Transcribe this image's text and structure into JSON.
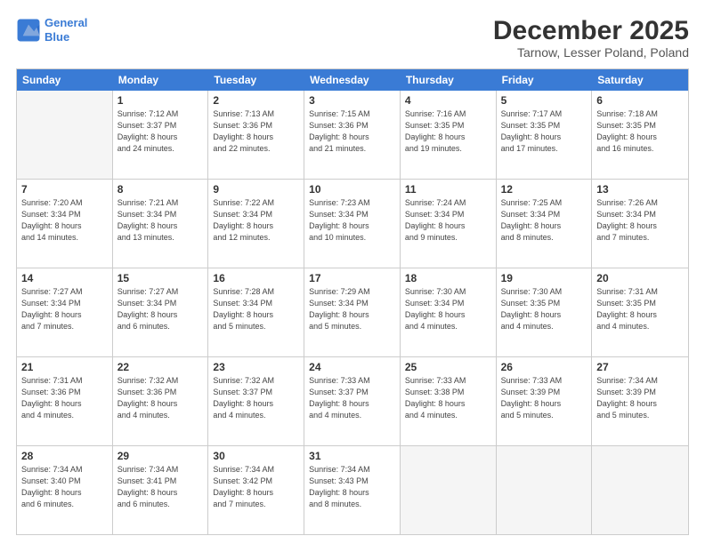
{
  "logo": {
    "line1": "General",
    "line2": "Blue"
  },
  "title": "December 2025",
  "location": "Tarnow, Lesser Poland, Poland",
  "header_days": [
    "Sunday",
    "Monday",
    "Tuesday",
    "Wednesday",
    "Thursday",
    "Friday",
    "Saturday"
  ],
  "weeks": [
    [
      {
        "day": "",
        "info": ""
      },
      {
        "day": "1",
        "info": "Sunrise: 7:12 AM\nSunset: 3:37 PM\nDaylight: 8 hours\nand 24 minutes."
      },
      {
        "day": "2",
        "info": "Sunrise: 7:13 AM\nSunset: 3:36 PM\nDaylight: 8 hours\nand 22 minutes."
      },
      {
        "day": "3",
        "info": "Sunrise: 7:15 AM\nSunset: 3:36 PM\nDaylight: 8 hours\nand 21 minutes."
      },
      {
        "day": "4",
        "info": "Sunrise: 7:16 AM\nSunset: 3:35 PM\nDaylight: 8 hours\nand 19 minutes."
      },
      {
        "day": "5",
        "info": "Sunrise: 7:17 AM\nSunset: 3:35 PM\nDaylight: 8 hours\nand 17 minutes."
      },
      {
        "day": "6",
        "info": "Sunrise: 7:18 AM\nSunset: 3:35 PM\nDaylight: 8 hours\nand 16 minutes."
      }
    ],
    [
      {
        "day": "7",
        "info": "Sunrise: 7:20 AM\nSunset: 3:34 PM\nDaylight: 8 hours\nand 14 minutes."
      },
      {
        "day": "8",
        "info": "Sunrise: 7:21 AM\nSunset: 3:34 PM\nDaylight: 8 hours\nand 13 minutes."
      },
      {
        "day": "9",
        "info": "Sunrise: 7:22 AM\nSunset: 3:34 PM\nDaylight: 8 hours\nand 12 minutes."
      },
      {
        "day": "10",
        "info": "Sunrise: 7:23 AM\nSunset: 3:34 PM\nDaylight: 8 hours\nand 10 minutes."
      },
      {
        "day": "11",
        "info": "Sunrise: 7:24 AM\nSunset: 3:34 PM\nDaylight: 8 hours\nand 9 minutes."
      },
      {
        "day": "12",
        "info": "Sunrise: 7:25 AM\nSunset: 3:34 PM\nDaylight: 8 hours\nand 8 minutes."
      },
      {
        "day": "13",
        "info": "Sunrise: 7:26 AM\nSunset: 3:34 PM\nDaylight: 8 hours\nand 7 minutes."
      }
    ],
    [
      {
        "day": "14",
        "info": "Sunrise: 7:27 AM\nSunset: 3:34 PM\nDaylight: 8 hours\nand 7 minutes."
      },
      {
        "day": "15",
        "info": "Sunrise: 7:27 AM\nSunset: 3:34 PM\nDaylight: 8 hours\nand 6 minutes."
      },
      {
        "day": "16",
        "info": "Sunrise: 7:28 AM\nSunset: 3:34 PM\nDaylight: 8 hours\nand 5 minutes."
      },
      {
        "day": "17",
        "info": "Sunrise: 7:29 AM\nSunset: 3:34 PM\nDaylight: 8 hours\nand 5 minutes."
      },
      {
        "day": "18",
        "info": "Sunrise: 7:30 AM\nSunset: 3:34 PM\nDaylight: 8 hours\nand 4 minutes."
      },
      {
        "day": "19",
        "info": "Sunrise: 7:30 AM\nSunset: 3:35 PM\nDaylight: 8 hours\nand 4 minutes."
      },
      {
        "day": "20",
        "info": "Sunrise: 7:31 AM\nSunset: 3:35 PM\nDaylight: 8 hours\nand 4 minutes."
      }
    ],
    [
      {
        "day": "21",
        "info": "Sunrise: 7:31 AM\nSunset: 3:36 PM\nDaylight: 8 hours\nand 4 minutes."
      },
      {
        "day": "22",
        "info": "Sunrise: 7:32 AM\nSunset: 3:36 PM\nDaylight: 8 hours\nand 4 minutes."
      },
      {
        "day": "23",
        "info": "Sunrise: 7:32 AM\nSunset: 3:37 PM\nDaylight: 8 hours\nand 4 minutes."
      },
      {
        "day": "24",
        "info": "Sunrise: 7:33 AM\nSunset: 3:37 PM\nDaylight: 8 hours\nand 4 minutes."
      },
      {
        "day": "25",
        "info": "Sunrise: 7:33 AM\nSunset: 3:38 PM\nDaylight: 8 hours\nand 4 minutes."
      },
      {
        "day": "26",
        "info": "Sunrise: 7:33 AM\nSunset: 3:39 PM\nDaylight: 8 hours\nand 5 minutes."
      },
      {
        "day": "27",
        "info": "Sunrise: 7:34 AM\nSunset: 3:39 PM\nDaylight: 8 hours\nand 5 minutes."
      }
    ],
    [
      {
        "day": "28",
        "info": "Sunrise: 7:34 AM\nSunset: 3:40 PM\nDaylight: 8 hours\nand 6 minutes."
      },
      {
        "day": "29",
        "info": "Sunrise: 7:34 AM\nSunset: 3:41 PM\nDaylight: 8 hours\nand 6 minutes."
      },
      {
        "day": "30",
        "info": "Sunrise: 7:34 AM\nSunset: 3:42 PM\nDaylight: 8 hours\nand 7 minutes."
      },
      {
        "day": "31",
        "info": "Sunrise: 7:34 AM\nSunset: 3:43 PM\nDaylight: 8 hours\nand 8 minutes."
      },
      {
        "day": "",
        "info": ""
      },
      {
        "day": "",
        "info": ""
      },
      {
        "day": "",
        "info": ""
      }
    ]
  ]
}
